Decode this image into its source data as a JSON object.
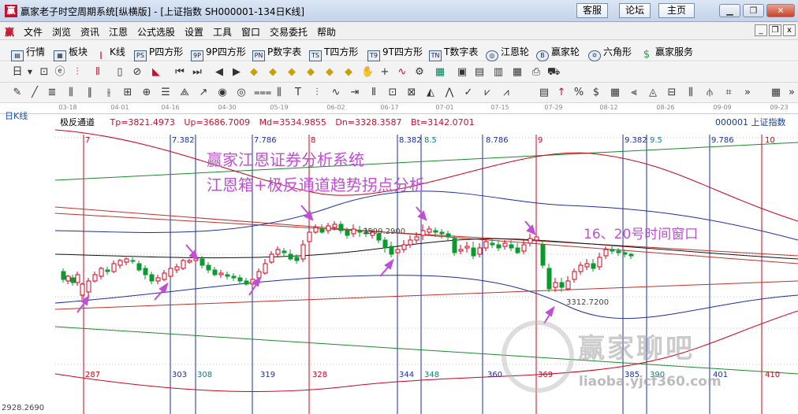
{
  "window": {
    "title": "赢家老子时空周期系统[纵横版] - [上证指数  SH000001-134日K线]",
    "buttons": [
      "客服",
      "论坛",
      "主页"
    ]
  },
  "menu": [
    "文件",
    "浏览",
    "资讯",
    "江恩",
    "公式选股",
    "设置",
    "工具",
    "窗口",
    "交易委托",
    "帮助"
  ],
  "toolbar1": [
    "行情",
    "板块",
    "K线",
    "P四方形",
    "9P四方形",
    "P数字表",
    "T四方形",
    "9T四方形",
    "T数字表",
    "江恩轮",
    "赢家轮",
    "六角形",
    "赢家服务"
  ],
  "dates": [
    "03-18",
    "04-01",
    "04-16",
    "04-30",
    "05-19",
    "06-02",
    "06-17",
    "07-01",
    "07-15",
    "07-29",
    "08-12",
    "08-26",
    "09-09",
    "09-23"
  ],
  "chart": {
    "period_label": "日K线",
    "indicator": "极反通道",
    "values": [
      "Tp=3821.4973",
      "Up=3686.7009",
      "Md=3534.9855",
      "Dn=3328.3587",
      "Bt=3142.0701"
    ],
    "code": "000001  上证指数",
    "bottom_price": "2928.2690",
    "price_marks": [
      "3599.2900",
      "3312.7200"
    ],
    "top_cycle_labels": [
      "7",
      "7.382",
      "7.786",
      "8",
      "8.382",
      "8.5",
      "8.786",
      "9",
      "9.382",
      "9.5",
      "9.786",
      "10"
    ],
    "bottom_cycle_labels": [
      "287",
      "303",
      "308",
      "319",
      "328",
      "344",
      "348",
      "360",
      "369",
      "385",
      "390",
      "401",
      "410"
    ]
  },
  "overlay": {
    "line1": "赢家江恩证券分析系统",
    "line2": "江恩箱+极反通道趋势拐点分析",
    "note": "16、20号时间窗口"
  },
  "watermark": {
    "text": "赢家聊吧",
    "url": "liaoba.yjcf360.com"
  },
  "colors": {
    "up": "#d0021b",
    "down": "#0a9a2e",
    "accent": "#c14ed6",
    "cycle_red": "#d0021b",
    "cycle_blue": "#1a2fa0"
  }
}
